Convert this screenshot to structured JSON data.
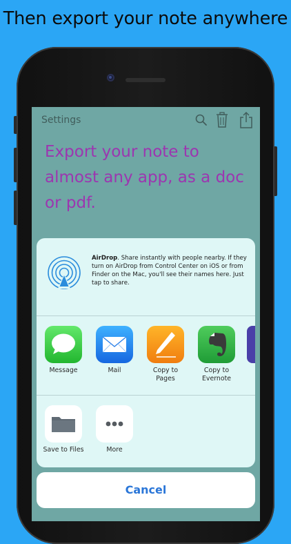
{
  "headline": "Then export your note anywhere",
  "app_bar": {
    "settings_label": "Settings",
    "icons": [
      "search-icon",
      "trash-icon",
      "share-icon"
    ]
  },
  "note": {
    "text": "Export your note to almost any app, as a doc or pdf."
  },
  "share_sheet": {
    "airdrop": {
      "title": "AirDrop",
      "description": ". Share instantly with people nearby. If they turn on AirDrop from Control Center on iOS or from Finder on the Mac, you'll see their names here. Just tap to share.",
      "icon": "airdrop-icon"
    },
    "apps": [
      {
        "label": "Message",
        "icon": "message-icon",
        "color": "#3ed04a"
      },
      {
        "label": "Mail",
        "icon": "mail-icon",
        "color": "#2a8ff2"
      },
      {
        "label": "Copy to Pages",
        "icon": "pages-icon",
        "color": "#f59a1a"
      },
      {
        "label": "Copy to Evernote",
        "icon": "evernote-icon",
        "color": "#2fb347"
      }
    ],
    "actions": [
      {
        "label": "Save to Files",
        "icon": "folder-icon"
      },
      {
        "label": "More",
        "icon": "more-icon"
      }
    ],
    "cancel_label": "Cancel"
  },
  "colors": {
    "background": "#2ba6f5",
    "note_text": "#9c36b0",
    "note_background": "#6fa7a4",
    "sheet_background": "#dff7f6",
    "cancel_text": "#2a76d8"
  }
}
